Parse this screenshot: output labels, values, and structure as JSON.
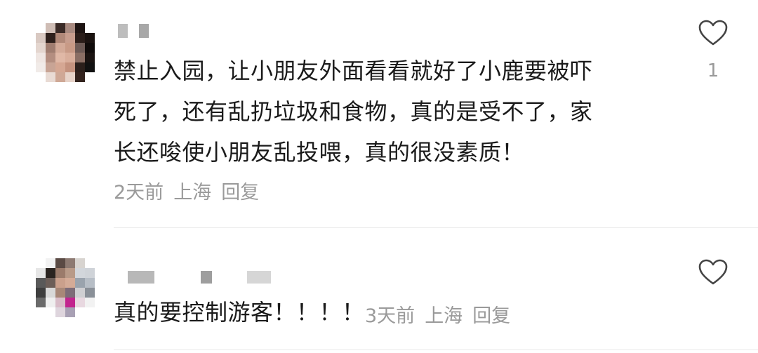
{
  "comments": [
    {
      "lines": [
        "禁止入园，让小朋友外面看看就好了小鹿要被吓",
        "死了，还有乱扔垃圾和食物，真的是受不了，家",
        "长还唆使小朋友乱投喂，真的很没素质！"
      ],
      "time": "2天前",
      "location": "上海",
      "reply_label": "回复",
      "likes": "1"
    },
    {
      "text": "真的要控制游客！！！！",
      "time": "3天前",
      "location": "上海",
      "reply_label": "回复",
      "likes": ""
    }
  ]
}
